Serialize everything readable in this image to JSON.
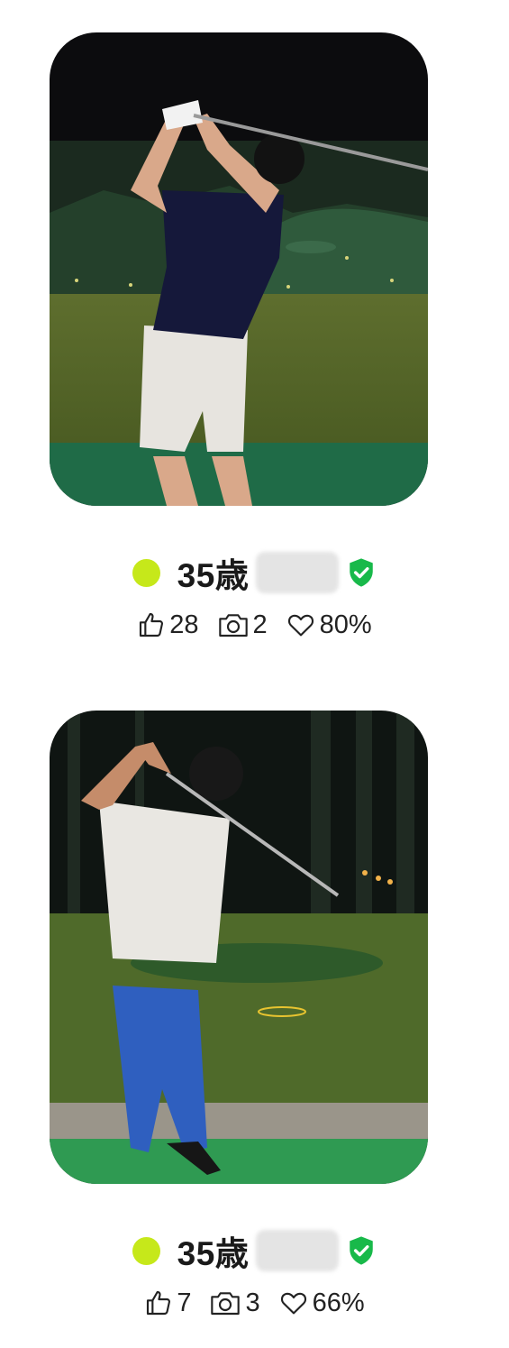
{
  "profiles": [
    {
      "age": "35歳",
      "online_color": "#c6e81a",
      "verified_color": "#18b94a",
      "likes": "28",
      "photos": "2",
      "match": "80%"
    },
    {
      "age": "35歳",
      "online_color": "#c6e81a",
      "verified_color": "#18b94a",
      "likes": "7",
      "photos": "3",
      "match": "66%"
    }
  ],
  "icons": {
    "online": "online-status-dot",
    "verified": "verified-shield-icon",
    "likes": "thumbs-up-icon",
    "photos": "camera-icon",
    "match": "heart-icon"
  }
}
